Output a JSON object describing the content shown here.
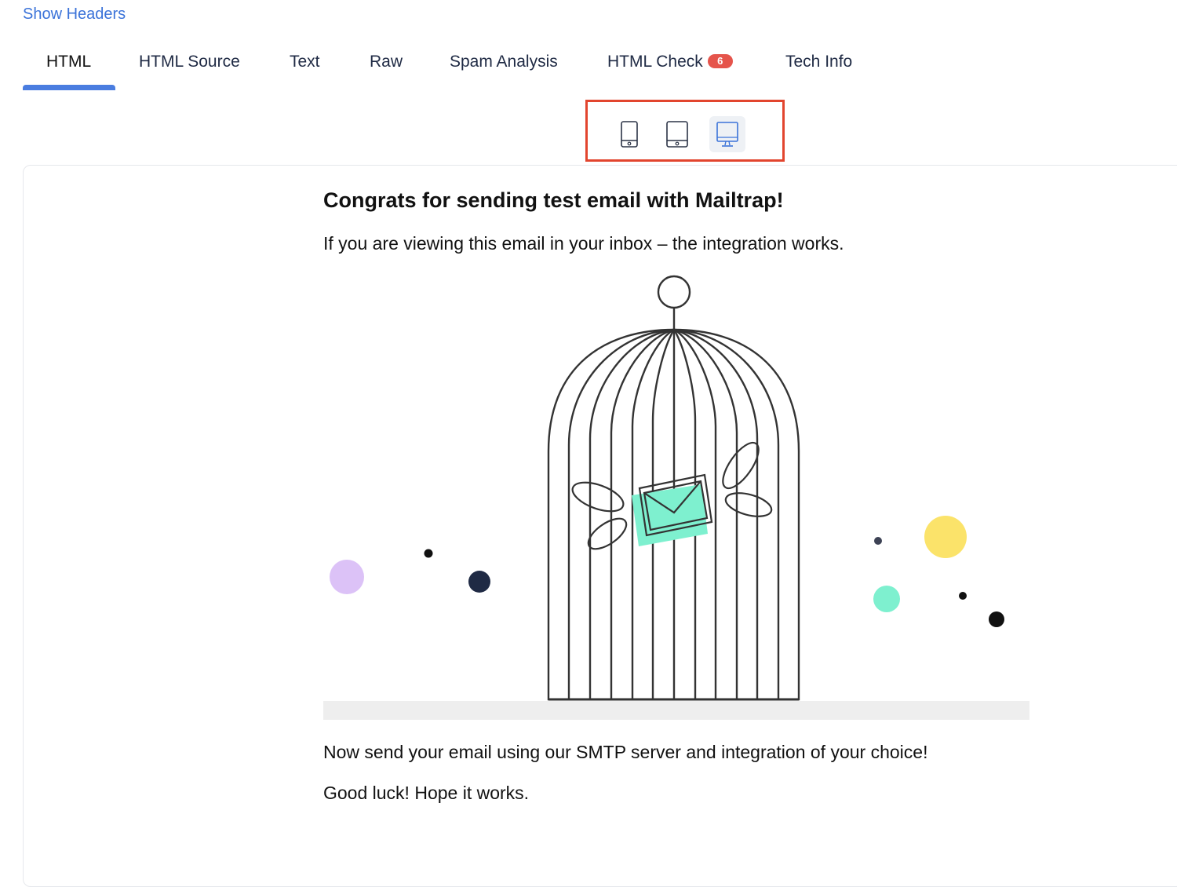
{
  "header": {
    "show_headers_link": "Show Headers"
  },
  "tabs": [
    {
      "label": "HTML",
      "active": true
    },
    {
      "label": "HTML Source"
    },
    {
      "label": "Text"
    },
    {
      "label": "Raw"
    },
    {
      "label": "Spam Analysis"
    },
    {
      "label": "HTML Check",
      "badge": "6"
    },
    {
      "label": "Tech Info"
    }
  ],
  "device_toggle": {
    "options": [
      "phone-icon",
      "tablet-icon",
      "desktop-icon"
    ],
    "selected": "desktop-icon"
  },
  "email": {
    "title": "Congrats for sending test email with Mailtrap!",
    "intro": "If you are viewing this email in your inbox – the integration works.",
    "body": "Now send your email using our SMTP server and integration of your choice!",
    "signoff": "Good luck! Hope it works."
  },
  "colors": {
    "link": "#3b73d9",
    "tab_underline": "#4a7de0",
    "badge": "#e5544b",
    "highlight_box": "#e2452e",
    "envelope": "#7ef0cf",
    "dot_purple": "#dcc2f7",
    "dot_yellow": "#fbe36a",
    "dot_teal": "#7ef0cf",
    "dot_navy": "#1f2a44"
  }
}
